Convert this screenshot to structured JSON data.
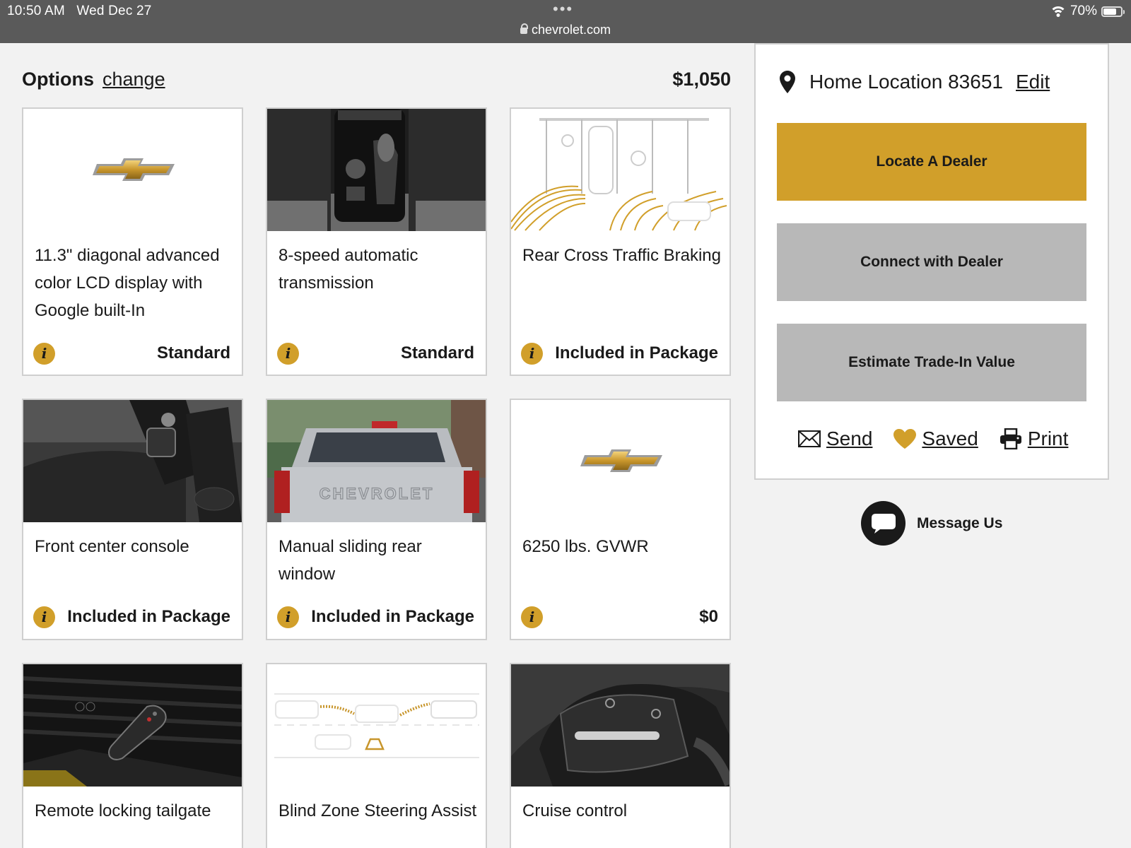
{
  "status_bar": {
    "time": "10:50 AM",
    "date": "Wed Dec 27",
    "url": "chevrolet.com",
    "battery": "70%",
    "battery_level": 0.7,
    "icons": [
      "lock-icon",
      "wifi-icon",
      "battery-icon"
    ]
  },
  "options": {
    "title": "Options",
    "change_label": "change",
    "total": "$1,050"
  },
  "cards": [
    {
      "title": "11.3\" diagonal advanced color LCD display with Google built-In",
      "status": "Standard",
      "image": "chevrolet-logo"
    },
    {
      "title": "8-speed automatic transmission",
      "status": "Standard",
      "image": "shifter-photo"
    },
    {
      "title": "Rear Cross Traffic Braking",
      "status": "Included in Package",
      "image": "rear-cross-traffic-diagram"
    },
    {
      "title": "Front center console",
      "status": "Included in Package",
      "image": "console-photo"
    },
    {
      "title": "Manual sliding rear window",
      "status": "Included in Package",
      "image": "rear-window-photo",
      "badge_text": "CHEVROLET"
    },
    {
      "title": "6250 lbs. GVWR",
      "status": "$0",
      "image": "chevrolet-logo"
    },
    {
      "title": "Remote locking tailgate",
      "status": "",
      "image": "key-fob-photo"
    },
    {
      "title": "Blind Zone Steering Assist",
      "status": "",
      "image": "blind-zone-diagram"
    },
    {
      "title": "Cruise control",
      "status": "",
      "image": "steering-wheel-photo"
    }
  ],
  "info_symbol": "i",
  "panel": {
    "location_label": "Home Location 83651",
    "edit_label": "Edit",
    "buttons": {
      "locate": "Locate A Dealer",
      "connect": "Connect with Dealer",
      "trade": "Estimate Trade-In Value"
    },
    "actions": {
      "send": "Send",
      "saved": "Saved",
      "print": "Print"
    }
  },
  "message": {
    "label": "Message Us"
  },
  "colors": {
    "gold": "#d19f2a",
    "gray_button": "#b8b8b8",
    "status_bar": "#5a5a5a"
  }
}
